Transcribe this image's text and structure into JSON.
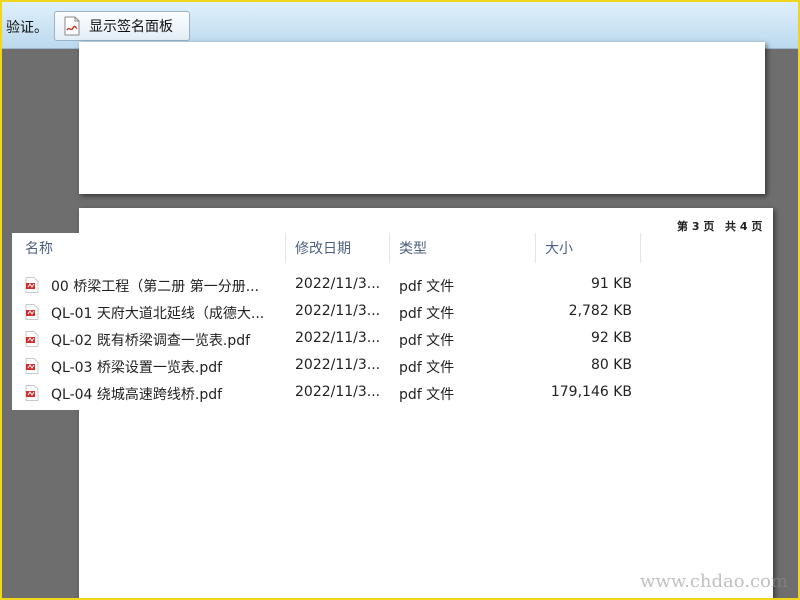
{
  "toolbar": {
    "cut_text": "验证。",
    "show_signature_panel_label": "显示签名面板",
    "show_signature_panel_icon": "signature-panel-icon"
  },
  "document": {
    "page2_number_1": "第 3 页",
    "page2_number_2": "共 4 页"
  },
  "file_list": {
    "columns": {
      "name": "名称",
      "modified": "修改日期",
      "type": "类型",
      "size": "大小"
    },
    "files": [
      {
        "name": "00 桥梁工程（第二册 第一分册...",
        "modified": "2022/11/3...",
        "type": "pdf 文件",
        "size": "91 KB",
        "icon": "pdf-file-icon"
      },
      {
        "name": "QL-01 天府大道北延线（成德大...",
        "modified": "2022/11/3...",
        "type": "pdf 文件",
        "size": "2,782 KB",
        "icon": "pdf-file-icon"
      },
      {
        "name": "QL-02 既有桥梁调查一览表.pdf",
        "modified": "2022/11/3...",
        "type": "pdf 文件",
        "size": "92 KB",
        "icon": "pdf-file-icon"
      },
      {
        "name": "QL-03 桥梁设置一览表.pdf",
        "modified": "2022/11/3...",
        "type": "pdf 文件",
        "size": "80 KB",
        "icon": "pdf-file-icon"
      },
      {
        "name": "QL-04 绕城高速跨线桥.pdf",
        "modified": "2022/11/3...",
        "type": "pdf 文件",
        "size": "179,146 KB",
        "icon": "pdf-file-icon"
      }
    ]
  },
  "watermark_bottom": "www.chdao.com",
  "colors": {
    "frame_border": "#f1d61c",
    "toolbar_bg": "#cfe6f5",
    "pdf_icon": "#d42b2b",
    "header_text": "#4d6082"
  }
}
